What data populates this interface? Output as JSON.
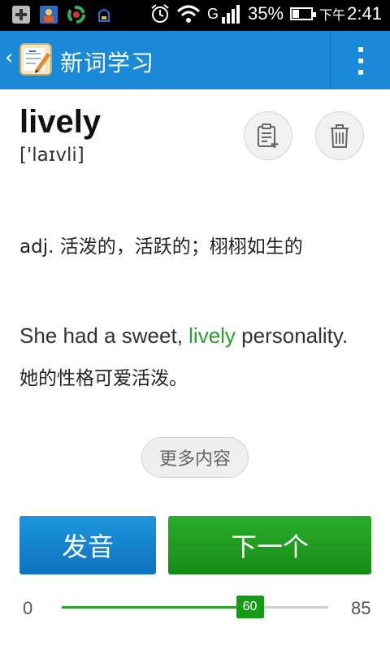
{
  "status_bar": {
    "battery_percent": "35%",
    "battery_level": 0.35,
    "time_prefix": "下午",
    "time": "2:41",
    "network": "G"
  },
  "action_bar": {
    "title": "新词学习",
    "back_icon": "back-arrow-icon",
    "app_icon": "notebook-pencil-icon",
    "overflow_icon": "overflow-menu-icon"
  },
  "word": {
    "text": "lively",
    "phonetic": "['laɪvli]"
  },
  "actions": {
    "add_note_icon": "add-note-icon",
    "delete_icon": "trash-icon"
  },
  "definition": "adj. 活泼的，活跃的；栩栩如生的",
  "example": {
    "before": "She had a sweet, ",
    "highlight": "lively",
    "after": " personality.",
    "translation": "她的性格可爱活泼。",
    "highlight_color": "#2a9d2a"
  },
  "more_button": "更多内容",
  "buttons": {
    "speak": "发音",
    "next": "下一个"
  },
  "progress": {
    "min": "0",
    "max": "85",
    "value": "60",
    "value_num": 60,
    "max_num": 85
  },
  "colors": {
    "action_bar": "#1a8ad8",
    "speak_button": "#1383cf",
    "next_button": "#1f9e1f"
  }
}
